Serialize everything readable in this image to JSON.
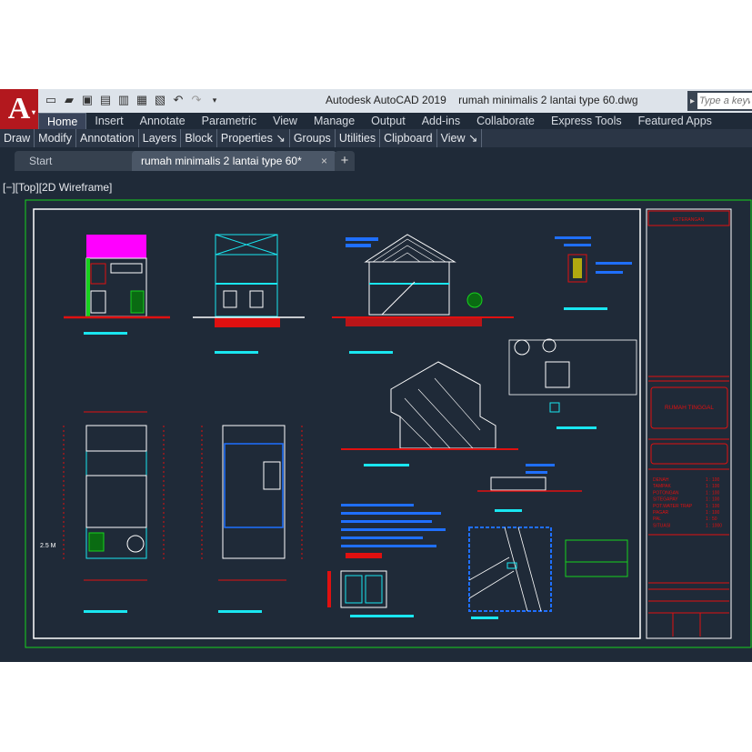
{
  "title": {
    "app": "Autodesk AutoCAD 2019",
    "file": "rumah minimalis 2 lantai type 60.dwg"
  },
  "search": {
    "placeholder": "Type a keyw"
  },
  "ribbon_tabs": [
    "Home",
    "Insert",
    "Annotate",
    "Parametric",
    "View",
    "Manage",
    "Output",
    "Add-ins",
    "Collaborate",
    "Express Tools",
    "Featured Apps"
  ],
  "panels": [
    "Draw",
    "Modify",
    "Annotation",
    "Layers",
    "Block",
    "Properties ↘",
    "Groups",
    "Utilities",
    "Clipboard",
    "View ↘"
  ],
  "doc_tabs": {
    "start": "Start",
    "drawing": "rumah minimalis 2 lantai type 60*",
    "close": "×",
    "new": "+"
  },
  "viewport_label": "[−][Top][2D Wireframe]",
  "drawing": {
    "title_block_header": "KETERANGAN",
    "project_name": "RUMAH TINGGAL",
    "sheet_list": [
      {
        "name": "DENAH",
        "scale": "1 : 100"
      },
      {
        "name": "TAMPAK",
        "scale": "1 : 100"
      },
      {
        "name": "POTONGAN",
        "scale": "1 : 100"
      },
      {
        "name": "SITEGAPAY",
        "scale": "1 : 100"
      },
      {
        "name": "POT.WATER TRAP",
        "scale": "1 : 100"
      },
      {
        "name": "PAGAR",
        "scale": "1 : 100"
      },
      {
        "name": "PAL",
        "scale": "1 : 50"
      },
      {
        "name": "SITUASI",
        "scale": "1 : 1000"
      }
    ],
    "dimension": "2.5 M",
    "colors": {
      "background": "#1f2a38",
      "frame_green": "#17d31e",
      "cyan": "#19e6f0",
      "red": "#e01010",
      "blue": "#1f6fff",
      "magenta": "#ff00ff",
      "white": "#ffffff",
      "yellow": "#f0e000"
    }
  },
  "icons": [
    "autocad-logo-icon",
    "new-icon",
    "open-icon",
    "save-icon",
    "save-as-icon",
    "open-web-icon",
    "save-web-icon",
    "plot-icon",
    "undo-icon",
    "redo-icon",
    "qat-menu-icon"
  ]
}
